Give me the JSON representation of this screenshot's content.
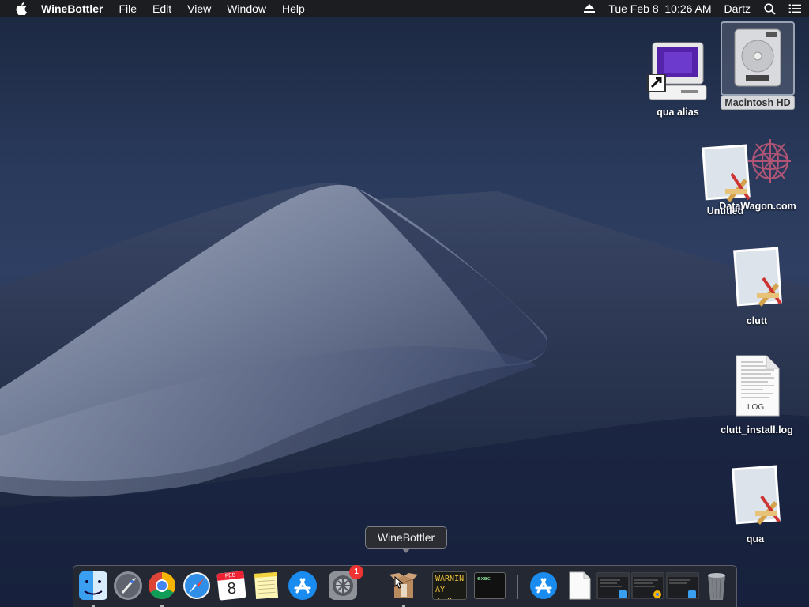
{
  "menubar": {
    "app_name": "WineBottler",
    "menus": [
      "File",
      "Edit",
      "View",
      "Window",
      "Help"
    ],
    "clock": "Tue Feb 8  10:26 AM",
    "user": "Dartz"
  },
  "desktop": {
    "icons": [
      {
        "label": "qua alias",
        "icon": "computer-alias-icon"
      },
      {
        "label": "Macintosh HD",
        "icon": "hard-drive-icon",
        "selected": true
      },
      {
        "label": "DataWagon.com",
        "icon": "web-globe-icon"
      },
      {
        "label": "Untitled",
        "icon": "application-script-icon"
      },
      {
        "label": "clutt",
        "icon": "application-script-icon"
      },
      {
        "label": "clutt_install.log",
        "icon": "log-file-icon",
        "badge": "LOG"
      },
      {
        "label": "qua",
        "icon": "application-script-icon"
      }
    ]
  },
  "dock": {
    "tooltip": "WineBottler",
    "items": [
      {
        "name": "Finder",
        "running": true
      },
      {
        "name": "Launchpad",
        "running": false
      },
      {
        "name": "Google Chrome",
        "running": true
      },
      {
        "name": "Safari",
        "running": false
      },
      {
        "name": "Calendar",
        "running": false,
        "month": "FEB",
        "day": "8"
      },
      {
        "name": "Notes",
        "running": false
      },
      {
        "name": "App Store",
        "running": false
      },
      {
        "name": "System Preferences",
        "running": false,
        "badge": "1"
      },
      {
        "name": "WineBottler",
        "running": true
      },
      {
        "name": "Console",
        "running": false,
        "text_line1": "WARNIN",
        "text_line2": "AY 7:36"
      },
      {
        "name": "Terminal",
        "running": false,
        "text": "exec"
      },
      {
        "name": "App Store folder",
        "running": false
      },
      {
        "name": "Document",
        "running": false
      },
      {
        "name": "Finder window",
        "running": false
      },
      {
        "name": "Chrome window",
        "running": false
      },
      {
        "name": "Finder window 2",
        "running": false
      },
      {
        "name": "Trash",
        "running": false
      }
    ]
  }
}
